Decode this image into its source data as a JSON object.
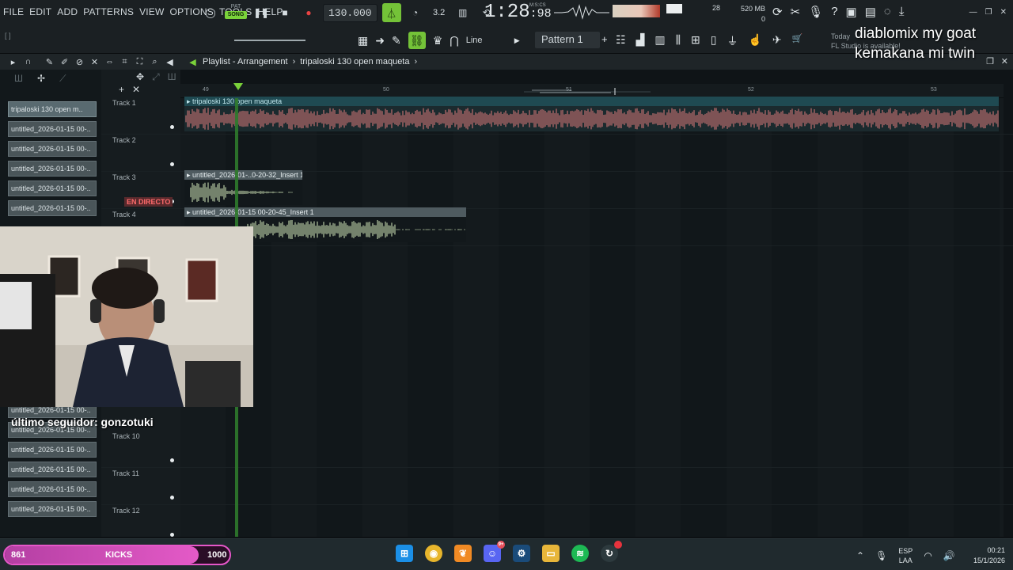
{
  "menu": [
    "FILE",
    "EDIT",
    "ADD",
    "PATTERNS",
    "VIEW",
    "OPTIONS",
    "TOOLS",
    "HELP"
  ],
  "transport": {
    "pat_label": "PAT",
    "song_label": "SONG",
    "tempo": "130.000",
    "time_sig_icon": "3.2",
    "clock_main": "1:28",
    "clock_frac": "98",
    "clock_unit": "M:S:CS"
  },
  "status": {
    "cpu": "28",
    "memory": "520 MB",
    "memory_sub": "0"
  },
  "toolbar2": {
    "snap_mode": "Line",
    "pattern": "Pattern 1",
    "news_line1": "Today",
    "news_line2": "FL Studio is available!"
  },
  "overlay_text": {
    "line1": "diablomix my goat",
    "line2": "kemakana mi twin"
  },
  "playlist": {
    "title": "Playlist - Arrangement",
    "arrangement": "tripaloski 130 open maqueta",
    "bars": [
      "49",
      "50",
      "51",
      "52",
      "53"
    ],
    "picker_items": [
      "tripaloski 130 open m..",
      "untitled_2026-01-15 00-..",
      "untitled_2026-01-15 00-..",
      "untitled_2026-01-15 00-..",
      "untitled_2026-01-15 00-..",
      "untitled_2026-01-15 00-..",
      "untitled_2026-01-15 00-..",
      "untitled_2026-01-15 00-..",
      "untitled_2026-01-15 00-..",
      "untitled_2026-01-15 00-..",
      "untitled_2026-01-15 00-..",
      "untitled_2026-01-15 00-.."
    ],
    "tracks": [
      "Track 1",
      "Track 2",
      "Track 3",
      "Track 4",
      "Track 10",
      "Track 11",
      "Track 12"
    ],
    "clips": {
      "clip1": "tripaloski 130 open maqueta",
      "clip3": "untitled_2026-01-..0-20-32_Insert 1",
      "clip4": "untitled_2026-01-15 00-20-45_Insert 1"
    }
  },
  "stream": {
    "live_badge": "EN DIRECTO",
    "last_follower": "último seguidor: gonzotuki",
    "goal": {
      "current": "861",
      "label": "KICKS",
      "target": "1000",
      "progress": 0.861
    }
  },
  "taskbar": {
    "apps": [
      "windows-start",
      "chrome",
      "fl-studio",
      "discord",
      "steam",
      "file-explorer",
      "spotify",
      "other-app"
    ],
    "discord_badge": "9+",
    "lang_top": "ESP",
    "lang_bottom": "LAA",
    "time": "00:21",
    "date": "15/1/2026"
  },
  "colors": {
    "accent_green": "#74c238",
    "audio_clip_wave": "#e07c7c",
    "insert_clip_wave": "#d7ecbe",
    "goal_pink": "#e657c9"
  }
}
